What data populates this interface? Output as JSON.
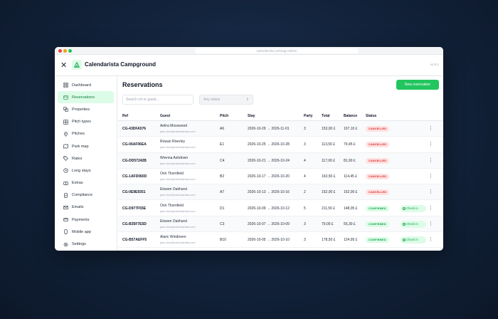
{
  "browser": {
    "url": "calendarista.com/app-admin"
  },
  "app": {
    "title": "Calendarista Campground",
    "version": "v1.0.1"
  },
  "sidebar": {
    "items": [
      {
        "label": "Dashboard",
        "icon": "dashboard-icon",
        "active": false
      },
      {
        "label": "Reservations",
        "icon": "calendar-icon",
        "active": true
      },
      {
        "label": "Properties",
        "icon": "properties-icon",
        "active": false
      },
      {
        "label": "Pitch types",
        "icon": "grid-icon",
        "active": false
      },
      {
        "label": "Pitches",
        "icon": "location-pin-icon",
        "active": false
      },
      {
        "label": "Park map",
        "icon": "map-icon",
        "active": false
      },
      {
        "label": "Rates",
        "icon": "tag-icon",
        "active": false
      },
      {
        "label": "Long stays",
        "icon": "clock-icon",
        "active": false
      },
      {
        "label": "Extras",
        "icon": "extras-icon",
        "active": false
      },
      {
        "label": "Compliance",
        "icon": "compliance-icon",
        "active": false
      },
      {
        "label": "Emails",
        "icon": "mail-icon",
        "active": false
      },
      {
        "label": "Payments",
        "icon": "card-icon",
        "active": false
      },
      {
        "label": "Mobile app",
        "icon": "mobile-icon",
        "active": false
      },
      {
        "label": "Settings",
        "icon": "gear-icon",
        "active": false
      }
    ]
  },
  "main": {
    "title": "Reservations",
    "new_button": "New reservation",
    "search_placeholder": "Search ref or guest...",
    "status_filter": "Any status",
    "columns": {
      "ref": "Ref",
      "guest": "Guest",
      "pitch": "Pitch",
      "stay": "Stay",
      "party": "Party",
      "total": "Total",
      "balance": "Balance",
      "status": "Status"
    },
    "check_in_label": "Check in",
    "rows": [
      {
        "ref": "CG-43DFA576",
        "guest": "Aelira Mosswood",
        "email": "jane.doe@calendarista.com",
        "pitch": "A6",
        "stay": "2026-10-29 → 2026-11-01",
        "party": "3",
        "total": "153,00 £",
        "balance": "107,10 £",
        "status": "CANCELLED",
        "check_in": false
      },
      {
        "ref": "CG-06AF06EA",
        "guest": "Rowan Riverley",
        "email": "jane.doe@calendarista.com",
        "pitch": "E1",
        "stay": "2026-10-25 → 2026-10-28",
        "party": "3",
        "total": "113,50 £",
        "balance": "79,45 £",
        "status": "CANCELLED",
        "check_in": false
      },
      {
        "ref": "CG-DD57242B",
        "guest": "Wrenna Ashdown",
        "email": "jane.doe@calendarista.com",
        "pitch": "C4",
        "stay": "2026-10-21 → 2026-10-24",
        "party": "4",
        "total": "117,00 £",
        "balance": "81,90 £",
        "status": "CANCELLED",
        "check_in": false
      },
      {
        "ref": "CG-1AFD060D",
        "guest": "Orin Thornfield",
        "email": "jane.doe@calendarista.com",
        "pitch": "B2",
        "stay": "2026-10-17 → 2026-10-20",
        "party": "4",
        "total": "163,50 £",
        "balance": "114,45 £",
        "status": "CANCELLED",
        "check_in": false
      },
      {
        "ref": "CG-0E9E9351",
        "guest": "Elowen Oakhurst",
        "email": "jane.doe@calendarista.com",
        "pitch": "A7",
        "stay": "2026-10-13 → 2026-10-16",
        "party": "2",
        "total": "152,00 £",
        "balance": "152,00 £",
        "status": "CANCELLED",
        "check_in": false
      },
      {
        "ref": "CG-D977F55E",
        "guest": "Orin Thornfield",
        "email": "jane.doe@calendarista.com",
        "pitch": "D1",
        "stay": "2026-10-09 → 2026-10-12",
        "party": "5",
        "total": "211,50 £",
        "balance": "148,05 £",
        "status": "CONFIRMED",
        "check_in": true
      },
      {
        "ref": "CG-B35F7E5D",
        "guest": "Elowen Oakhurst",
        "email": "jane.doe@calendarista.com",
        "pitch": "C3",
        "stay": "2026-10-07 → 2026-10-09",
        "party": "3",
        "total": "79,00 £",
        "balance": "55,30 £",
        "status": "CONFIRMED",
        "check_in": true
      },
      {
        "ref": "CG-B57AEFF5",
        "guest": "Alaric Windmere",
        "email": "jane.doe@calendarista.com",
        "pitch": "B10",
        "stay": "2026-10-05 → 2026-10-10",
        "party": "3",
        "total": "178,50 £",
        "balance": "124,95 £",
        "status": "CONFIRMED",
        "check_in": true
      }
    ]
  },
  "colors": {
    "accent": "#22c55e",
    "accent_soft": "#dcfce7",
    "danger": "#dc2626",
    "danger_soft": "#fee2e2"
  }
}
